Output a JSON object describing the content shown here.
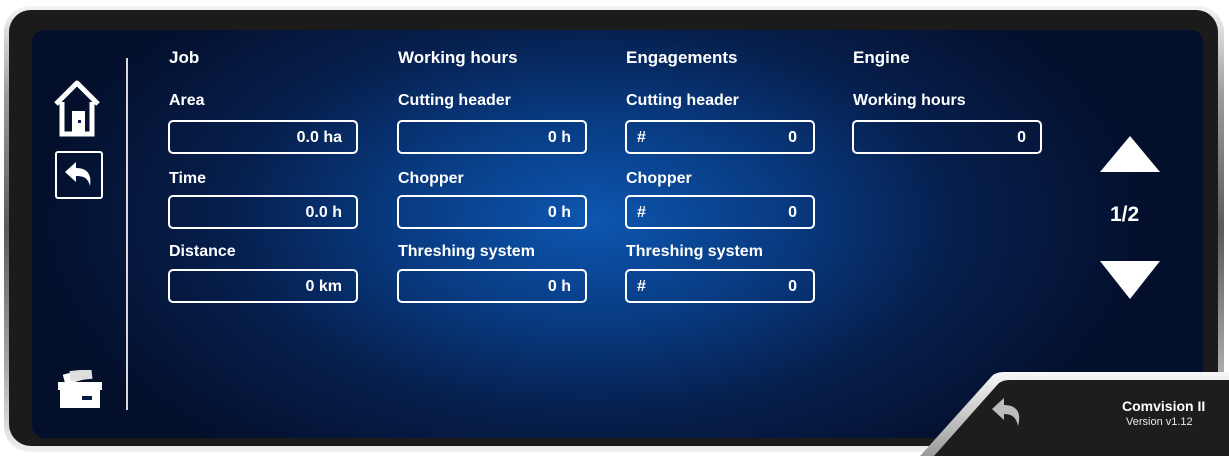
{
  "columns": {
    "job": "Job",
    "working_hours": "Working hours",
    "engagements": "Engagements",
    "engine": "Engine"
  },
  "job": {
    "area_label": "Area",
    "area_value": "0.0 ha",
    "time_label": "Time",
    "time_value": "0.0 h",
    "distance_label": "Distance",
    "distance_value": "0 km"
  },
  "working_hours": {
    "cutting_label": "Cutting header",
    "cutting_value": "0 h",
    "chopper_label": "Chopper",
    "chopper_value": "0 h",
    "threshing_label": "Threshing system",
    "threshing_value": "0 h"
  },
  "engagements": {
    "cutting_label": "Cutting header",
    "cutting_prefix": "#",
    "cutting_value": "0",
    "chopper_label": "Chopper",
    "chopper_prefix": "#",
    "chopper_value": "0",
    "threshing_label": "Threshing system",
    "threshing_prefix": "#",
    "threshing_value": "0"
  },
  "engine": {
    "hours_label": "Working hours",
    "hours_value": "0"
  },
  "pager": {
    "indicator": "1/2"
  },
  "footer": {
    "brand": "Comvision II",
    "version": "Version v1.12"
  },
  "icons": {
    "home": "home-icon",
    "undo": "undo-icon",
    "printer": "printer-icon",
    "up": "arrow-up-icon",
    "down": "arrow-down-icon",
    "back": "back-arrow-icon"
  },
  "colors": {
    "screen_center": "#0d56b0",
    "screen_edge": "#040f2c",
    "text": "#ffffff",
    "bezel": "#1b1b1b"
  }
}
